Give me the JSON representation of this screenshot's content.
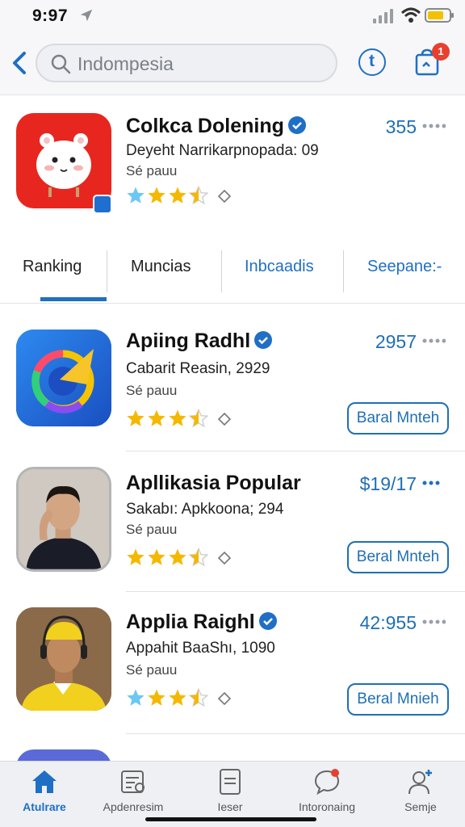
{
  "status_bar": {
    "time": "9:97"
  },
  "search": {
    "value": "Indompesia"
  },
  "header": {
    "t_label": "t",
    "cart_badge": "1"
  },
  "featured": {
    "title": "Colkca Dolening",
    "subtitle": "Deyeht Narrikarpnopada: 09",
    "meta": "Sé pauu",
    "count": "355",
    "rating": 3.5,
    "icon": "white-creature-icon"
  },
  "tabs": [
    {
      "label": "Ranking",
      "active": true
    },
    {
      "label": "Muncias",
      "active": false
    },
    {
      "label": "Inbcaadis",
      "active": false
    },
    {
      "label": "Seepane:-",
      "active": false
    }
  ],
  "apps": [
    {
      "title": "Apiing Radhl",
      "verified": true,
      "subtitle": "Cabarit Reasin, 2929",
      "meta": "Sé pauu",
      "count": "2957",
      "button": "Baral Mnteh",
      "rating": 3.5,
      "icon": "color-wheel-icon"
    },
    {
      "title": "Apllikasia Popular",
      "verified": false,
      "subtitle": "Sakabı: Apkkoona; 294",
      "meta": "Sé pauu",
      "count": "$19/17",
      "button": "Beral Mnteh",
      "rating": 3.5,
      "icon": "man-portrait"
    },
    {
      "title": "Applia Raighl",
      "verified": true,
      "subtitle": "Appahit BaaShı, 1090",
      "meta": "Sé pauu",
      "count": "42:955",
      "button": "Beral Mnieh",
      "rating": 3.5,
      "icon": "man-yellow-portrait"
    }
  ],
  "bottom_nav": [
    {
      "label": "Atulrare",
      "icon": "home-icon",
      "active": true
    },
    {
      "label": "Apdenresim",
      "icon": "chart-icon",
      "active": false
    },
    {
      "label": "Ieser",
      "icon": "document-icon",
      "active": false
    },
    {
      "label": "Intoronaing",
      "icon": "chat-icon",
      "active": false
    },
    {
      "label": "Semje",
      "icon": "add-user-icon",
      "active": false
    }
  ],
  "colors": {
    "accent": "#1f6fc5",
    "star": "#f5b800",
    "star_light": "#6cc8f2",
    "badge": "#e8402f"
  }
}
